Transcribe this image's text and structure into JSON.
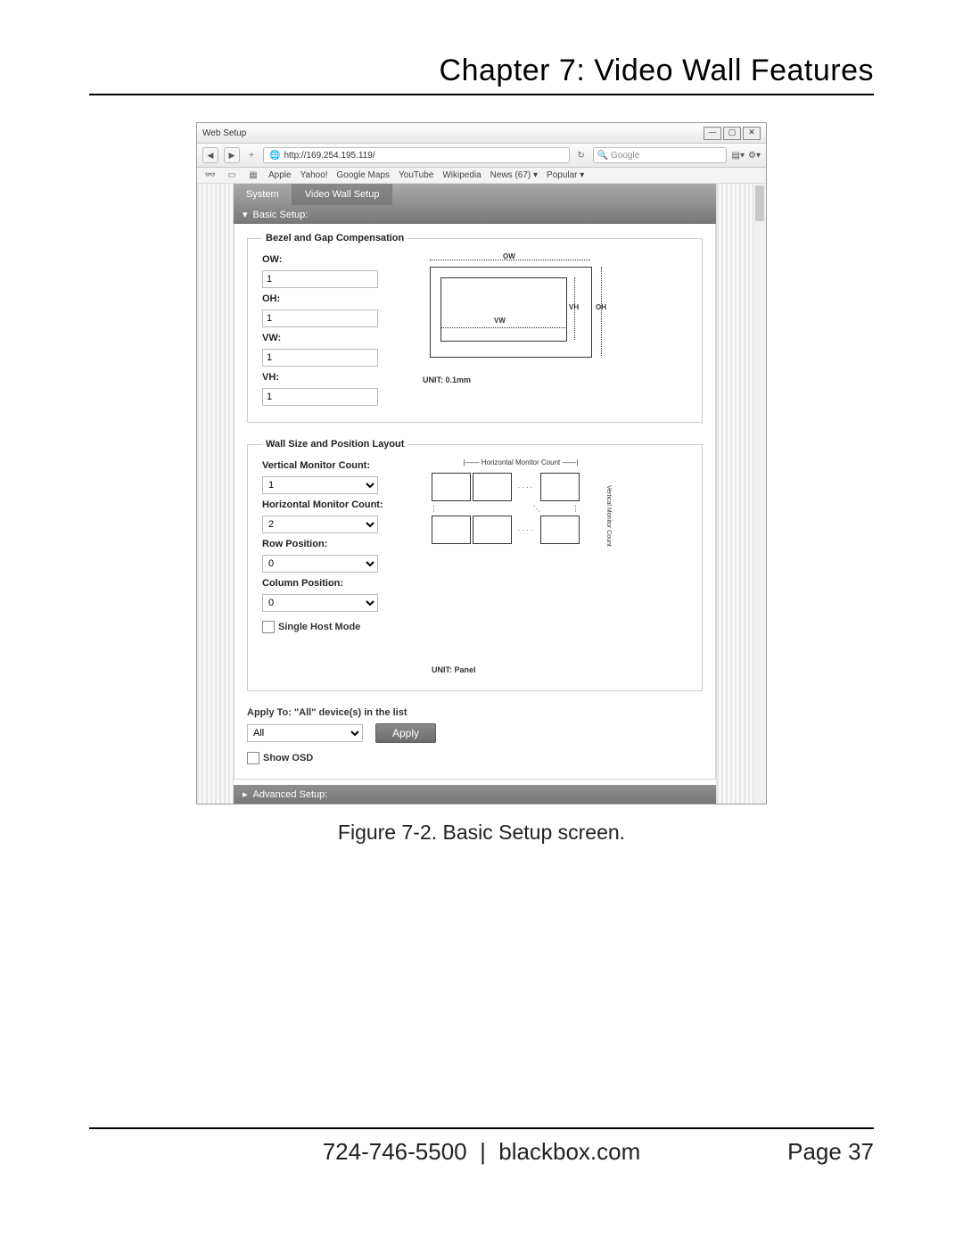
{
  "page": {
    "chapter_title": "Chapter 7: Video Wall Features",
    "caption": "Figure 7-2. Basic Setup screen.",
    "footer_phone": "724-746-5500",
    "footer_site": "blackbox.com",
    "footer_page": "Page 37"
  },
  "browser": {
    "window_title": "Web Setup",
    "url": "http://169.254.195.119/",
    "search_placeholder": "Google",
    "bookmarks": [
      "Apple",
      "Yahoo!",
      "Google Maps",
      "YouTube",
      "Wikipedia",
      "News (67) ▾",
      "Popular ▾"
    ]
  },
  "tabs": {
    "system": "System",
    "video_wall": "Video Wall Setup"
  },
  "sections": {
    "basic": "Basic Setup:",
    "advanced": "Advanced Setup:"
  },
  "bezel": {
    "legend": "Bezel and Gap Compensation",
    "ow_label": "OW:",
    "ow_value": "1",
    "oh_label": "OH:",
    "oh_value": "1",
    "vw_label": "VW:",
    "vw_value": "1",
    "vh_label": "VH:",
    "vh_value": "1",
    "d_ow": "OW",
    "d_oh": "OH",
    "d_vw": "VW",
    "d_vh": "VH",
    "unit": "UNIT: 0.1mm"
  },
  "wall": {
    "legend": "Wall Size and Position Layout",
    "vcount_label": "Vertical Monitor Count:",
    "vcount_value": "1",
    "hcount_label": "Horizontal Monitor Count:",
    "hcount_value": "2",
    "row_label": "Row Position:",
    "row_value": "0",
    "col_label": "Column Position:",
    "col_value": "0",
    "single_host": "Single Host Mode",
    "d_hlabel": "Horizontal Monitor Count",
    "d_vlabel": "Vertical Monitor Count",
    "unit": "UNIT: Panel"
  },
  "apply": {
    "label": "Apply To: \"All\" device(s) in the list",
    "select_value": "All",
    "button": "Apply",
    "show_osd": "Show OSD"
  }
}
